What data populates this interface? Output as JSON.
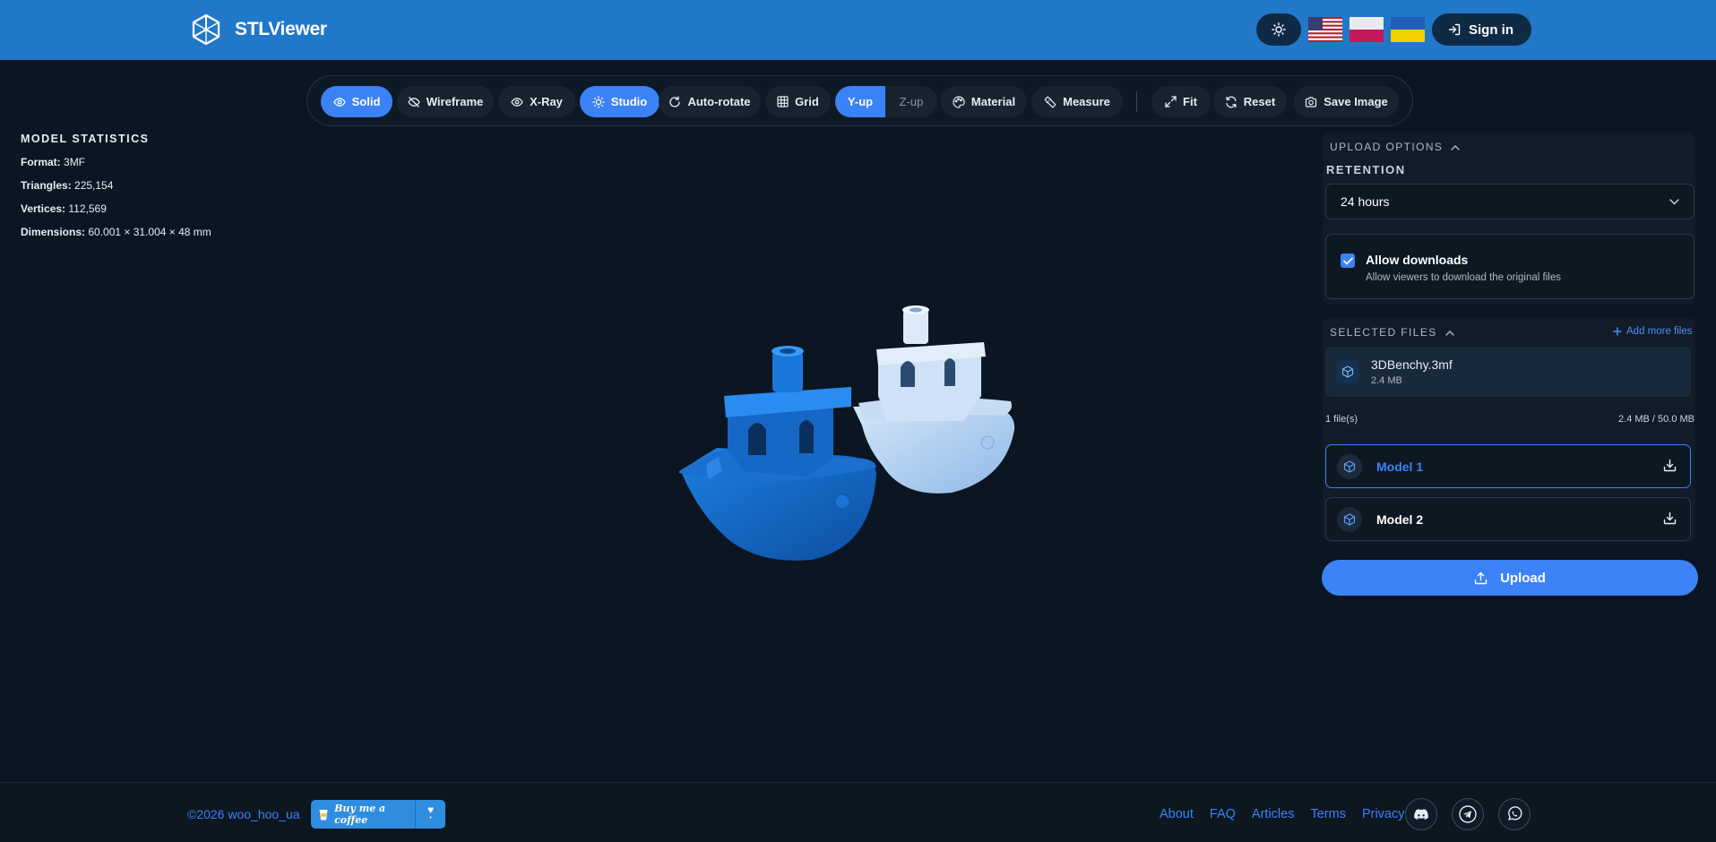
{
  "header": {
    "brand_name": "STLViewer",
    "signin_label": "Sign in",
    "languages": [
      "en-US",
      "pl",
      "uk"
    ]
  },
  "toolbar": {
    "solid": "Solid",
    "wireframe": "Wireframe",
    "xray": "X-Ray",
    "studio": "Studio",
    "autorotate": "Auto-rotate",
    "grid": "Grid",
    "yup": "Y-up",
    "zup": "Z-up",
    "material": "Material",
    "measure": "Measure",
    "fit": "Fit",
    "reset": "Reset",
    "save_image": "Save Image"
  },
  "stats": {
    "title": "MODEL STATISTICS",
    "format_label": "Format:",
    "format_value": "3MF",
    "triangles_label": "Triangles:",
    "triangles_value": "225,154",
    "vertices_label": "Vertices:",
    "vertices_value": "112,569",
    "dimensions_label": "Dimensions:",
    "dimensions_value": "60.001 × 31.004 × 48 mm"
  },
  "upload_options": {
    "title": "UPLOAD OPTIONS",
    "retention_label": "RETENTION",
    "retention_value": "24 hours",
    "allow_title": "Allow downloads",
    "allow_desc": "Allow viewers to download the original files",
    "allow_checked": true
  },
  "selected_files": {
    "title": "SELECTED FILES",
    "add_more": "Add more files",
    "file_name": "3DBenchy.3mf",
    "file_size": "2.4 MB",
    "count": "1 file(s)",
    "total": "2.4 MB / 50.0 MB",
    "models": [
      "Model 1",
      "Model 2"
    ]
  },
  "upload_label": "Upload",
  "footer": {
    "copyright": "©2026 woo_hoo_ua",
    "coffee": "Buy me a coffee",
    "links": [
      "About",
      "FAQ",
      "Articles",
      "Terms",
      "Privacy"
    ]
  },
  "colors": {
    "header_bg": "#2178c9",
    "accent": "#3b82f6",
    "page_bg": "#0b1622",
    "model_primary": "#1565c0",
    "model_secondary": "#a5c8f0"
  }
}
